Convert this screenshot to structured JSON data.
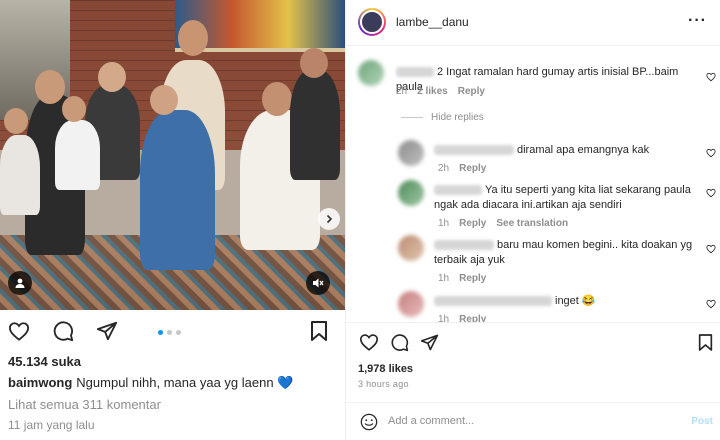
{
  "post": {
    "likes": "45.134 suka",
    "caption_user": "baimwong",
    "caption_text": "Ngumpul nihh, mana yaa yg laenn",
    "caption_emoji": "💙",
    "view_all": "Lihat semua 311 komentar",
    "time_ago": "11 jam yang lalu",
    "carousel_count": 3,
    "carousel_active": 1,
    "accent_color": "#0095f6"
  },
  "panel": {
    "username": "lambe__danu",
    "more_label": "···",
    "likes": "1,978 likes",
    "time": "3 hours ago",
    "add_comment_placeholder": "Add a comment...",
    "post_label": "Post",
    "hide_replies": "Hide replies",
    "comments": [
      {
        "text": "2 Ingat ramalan hard gumay artis inisial BP...baim paula",
        "time": "2h",
        "likes": "2 likes",
        "reply": "Reply"
      },
      {
        "text": "diramal apa emangnya kak",
        "time": "2h",
        "reply": "Reply"
      },
      {
        "text": "Ya itu seperti yang kita liat sekarang paula ngak ada diacara ini.artikan aja sendiri",
        "time": "1h",
        "reply": "Reply",
        "translation": "See translation"
      },
      {
        "text": "baru mau komen begini.. kita doakan yg terbaik aja yuk",
        "time": "1h",
        "reply": "Reply"
      },
      {
        "text": "inget 😂",
        "time": "1h",
        "reply": "Reply"
      }
    ]
  }
}
